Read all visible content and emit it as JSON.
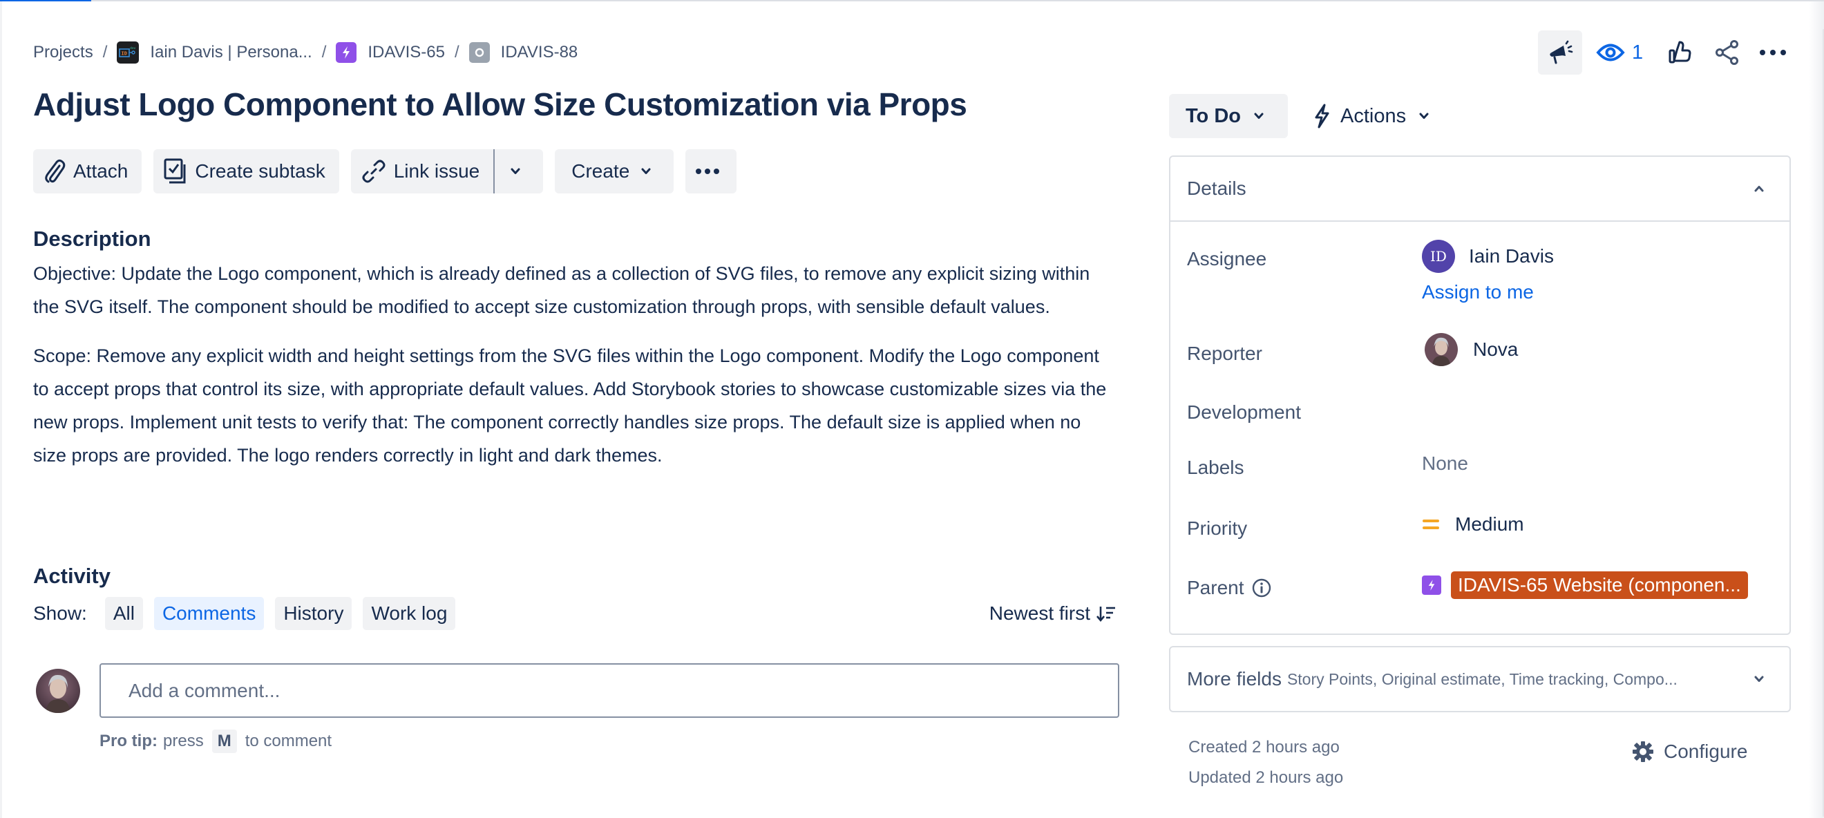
{
  "breadcrumb": {
    "items": [
      {
        "label": "Projects",
        "icon": null
      },
      {
        "label": "Iain Davis | Persona...",
        "icon": "project-avatar-icon"
      },
      {
        "label": "IDAVIS-65",
        "icon": "epic-icon"
      },
      {
        "label": "IDAVIS-88",
        "icon": "task-icon"
      }
    ],
    "separator": "/"
  },
  "header_actions": {
    "feedback": "megaphone-icon",
    "watchers_count": "1",
    "vote": "thumbs-up-icon",
    "share": "share-icon",
    "more": "more-icon"
  },
  "issue": {
    "title": "Adjust Logo Component to Allow Size Customization via Props"
  },
  "toolbar": {
    "attach_label": "Attach",
    "create_subtask_label": "Create subtask",
    "link_issue_label": "Link issue",
    "create_label": "Create"
  },
  "description": {
    "heading": "Description",
    "paragraphs": [
      "Objective: Update the Logo component, which is already defined as a collection of SVG files, to remove any explicit sizing within the SVG itself. The component should be modified to accept size customization through props, with sensible default values.",
      "Scope: Remove any explicit width and height settings from the SVG files within the Logo component. Modify the Logo component to accept props that control its size, with appropriate default values. Add Storybook stories to showcase customizable sizes via the new props. Implement unit tests to verify that: The component correctly handles size props. The default size is applied when no size props are provided. The logo renders correctly in light and dark themes."
    ]
  },
  "activity": {
    "heading": "Activity",
    "show_label": "Show:",
    "filters": [
      {
        "label": "All",
        "active": false
      },
      {
        "label": "Comments",
        "active": true
      },
      {
        "label": "History",
        "active": false
      },
      {
        "label": "Work log",
        "active": false
      }
    ],
    "sort_label": "Newest first",
    "comment_placeholder": "Add a comment...",
    "pro_tip_bold": "Pro tip:",
    "pro_tip_press": "press",
    "pro_tip_key": "M",
    "pro_tip_rest": "to comment"
  },
  "sidebar": {
    "status_label": "To Do",
    "actions_label": "Actions",
    "details_heading": "Details",
    "fields": {
      "assignee_label": "Assignee",
      "assignee_initials": "ID",
      "assignee_name": "Iain Davis",
      "assign_to_me": "Assign to me",
      "reporter_label": "Reporter",
      "reporter_name": "Nova",
      "development_label": "Development",
      "labels_label": "Labels",
      "labels_value": "None",
      "priority_label": "Priority",
      "priority_value": "Medium",
      "parent_label": "Parent",
      "parent_value": "IDAVIS-65 Website (componen..."
    },
    "more_fields_title": "More fields",
    "more_fields_sub": "Story Points, Original estimate, Time tracking, Compo...",
    "created": "Created 2 hours ago",
    "updated": "Updated 2 hours ago",
    "configure_label": "Configure"
  },
  "colors": {
    "primary": "#0c66e4",
    "text": "#172b4d",
    "epic": "#8f50e8",
    "priority_medium": "#f5a623",
    "parent_lozenge": "#c9501a",
    "assignee_avatar": "#5243aa"
  }
}
